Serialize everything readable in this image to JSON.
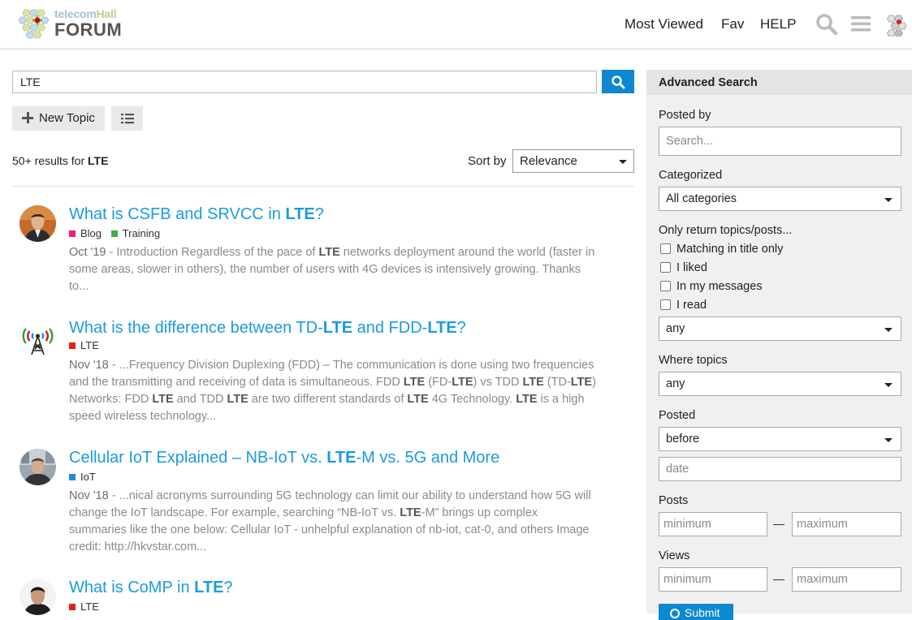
{
  "header": {
    "logo_small": "telecom",
    "logo_small_accent": "Hall",
    "logo_main": "FORUM",
    "nav": [
      "Most Viewed",
      "Fav",
      "HELP"
    ]
  },
  "search": {
    "query": "LTE",
    "new_topic_label": "New Topic"
  },
  "results_summary": {
    "count_text": "50+ results for ",
    "term": "LTE",
    "sort_label": "Sort by",
    "sort_value": "Relevance"
  },
  "results": [
    {
      "title_pre": "What is CSFB and SRVCC in ",
      "title_hl": "LTE",
      "title_post": "?",
      "cats": [
        {
          "name": "Blog",
          "color": "#e91e7a"
        },
        {
          "name": "Training",
          "color": "#3ab03e"
        }
      ],
      "date": "Oct '19",
      "blurb_parts": [
        " - Introduction Regardless of the pace of ",
        "LTE",
        " networks deployment around the world (faster in some areas, slower in others), the number of users with 4G devices is intensively growing. Thanks to..."
      ]
    },
    {
      "title_pre": "What is the difference between TD-",
      "title_hl": "LTE",
      "title_mid": " and FDD-",
      "title_hl2": "LTE",
      "title_post": "?",
      "cats": [
        {
          "name": "LTE",
          "color": "#e8201c"
        }
      ],
      "date": "Nov '18",
      "blurb_parts": [
        " - ...Frequency Division Duplexing (FDD) – The communication is done using two frequencies and the transmitting and receiving of data is simultaneous. FDD ",
        "LTE",
        " (FD-",
        "LTE",
        ") vs TDD ",
        "LTE",
        " (TD-",
        "LTE",
        ") Networks: FDD ",
        "LTE",
        " and TDD ",
        "LTE",
        " are two different standards of ",
        "LTE",
        " 4G Technology. ",
        "LTE",
        " is a high speed wireless technology..."
      ]
    },
    {
      "title_pre": "Cellular IoT Explained – NB-IoT vs. ",
      "title_hl": "LTE",
      "title_post": "-M vs. 5G and More",
      "cats": [
        {
          "name": "IoT",
          "color": "#1b8fd6"
        }
      ],
      "date": "Nov '18",
      "blurb_parts": [
        " - ...nical acronyms surrounding 5G technology can limit our ability to understand how 5G will change the IoT landscape. For example, searching “NB-IoT vs. ",
        "LTE",
        "-M” brings up complex summaries like the one below: Cellular IoT - unhelpful explanation of nb-iot, cat-0, and others Image credit: http://hkvstar.com..."
      ]
    },
    {
      "title_pre": "What is CoMP in ",
      "title_hl": "LTE",
      "title_post": "?",
      "cats": [
        {
          "name": "LTE",
          "color": "#e8201c"
        }
      ],
      "date": "",
      "blurb_parts": []
    }
  ],
  "sidebar": {
    "title": "Advanced Search",
    "posted_by_label": "Posted by",
    "posted_by_placeholder": "Search...",
    "categorized_label": "Categorized",
    "categorized_value": "All categories",
    "only_return_label": "Only return topics/posts...",
    "checkboxes": [
      "Matching in title only",
      "I liked",
      "In my messages",
      "I read"
    ],
    "only_return_value": "any",
    "where_label": "Where topics",
    "where_value": "any",
    "posted_label": "Posted",
    "posted_value": "before",
    "date_placeholder": "date",
    "posts_label": "Posts",
    "views_label": "Views",
    "min_placeholder": "minimum",
    "max_placeholder": "maximum",
    "submit_label": "Submit"
  },
  "colors": {
    "accent": "#0e88d0",
    "link": "#1a9be0"
  }
}
